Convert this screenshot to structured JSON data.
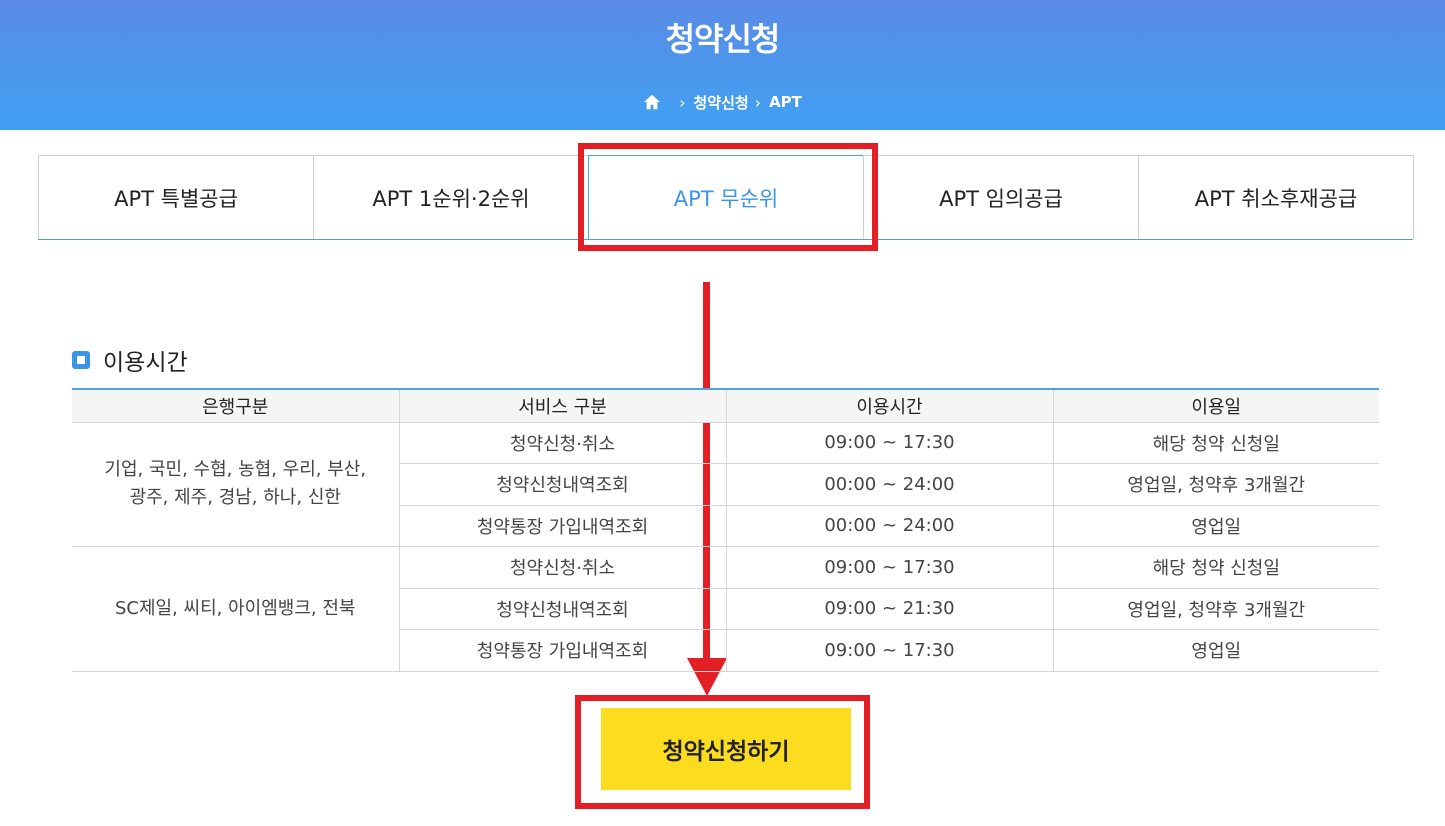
{
  "header": {
    "title": "청약신청",
    "breadcrumb": [
      "청약신청",
      "APT"
    ]
  },
  "tabs": [
    {
      "label": "APT 특별공급",
      "active": false
    },
    {
      "label": "APT 1순위·2순위",
      "active": false
    },
    {
      "label": "APT 무순위",
      "active": true
    },
    {
      "label": "APT 임의공급",
      "active": false
    },
    {
      "label": "APT 취소후재공급",
      "active": false
    }
  ],
  "section": {
    "title": "이용시간"
  },
  "table": {
    "headers": [
      "은행구분",
      "서비스 구분",
      "이용시간",
      "이용일"
    ],
    "groups": [
      {
        "banks_line1": "기업, 국민, 수협, 농협, 우리, 부산,",
        "banks_line2": "광주, 제주, 경남, 하나, 신한",
        "rows": [
          {
            "service": "청약신청·취소",
            "time": "09:00 ~ 17:30",
            "days": "해당 청약 신청일"
          },
          {
            "service": "청약신청내역조회",
            "time": "00:00 ~ 24:00",
            "days": "영업일, 청약후 3개월간"
          },
          {
            "service": "청약통장 가입내역조회",
            "time": "00:00 ~ 24:00",
            "days": "영업일"
          }
        ]
      },
      {
        "banks_line1": "SC제일, 씨티, 아이엠뱅크, 전북",
        "banks_line2": "",
        "rows": [
          {
            "service": "청약신청·취소",
            "time": "09:00 ~ 17:30",
            "days": "해당 청약 신청일"
          },
          {
            "service": "청약신청내역조회",
            "time": "09:00 ~ 21:30",
            "days": "영업일, 청약후 3개월간"
          },
          {
            "service": "청약통장 가입내역조회",
            "time": "09:00 ~ 17:30",
            "days": "영업일"
          }
        ]
      }
    ]
  },
  "apply_button": {
    "label": "청약신청하기",
    "color": "#fcdc1f"
  },
  "colors": {
    "accent": "#3b95e6",
    "highlight": "#e31e24"
  }
}
